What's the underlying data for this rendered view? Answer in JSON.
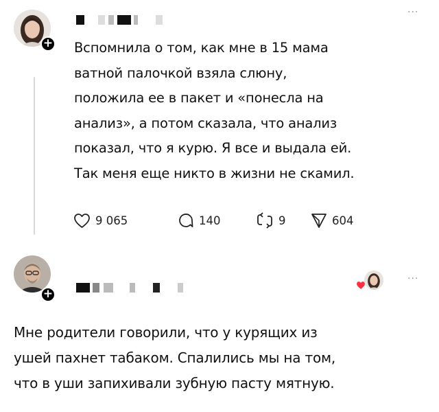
{
  "post1": {
    "text": "Вспомнила о том, как мне в 15 мама\nватной палочкой взяла слюну,\nположила ее в пакет и «понесла на\nанализ», а потом сказала, что анализ\nпоказал, что я курю. Я все и выдала ей.\nТак меня еще никто в жизни не скамил.",
    "more": "···",
    "plus": "+",
    "likes": "9 065",
    "comments": "140",
    "reposts": "9",
    "shares": "604"
  },
  "post2": {
    "text": "Мне родители говорили, что у курящих из\nушей пахнет табаком. Спалились мы на том,\nчто в уши запихивали зубную пасту мятную.",
    "more": "···",
    "plus": "+"
  },
  "colors": {
    "text": "#111111",
    "muted": "#999999",
    "line": "#d8d8d8",
    "heart": "#ff3040"
  }
}
